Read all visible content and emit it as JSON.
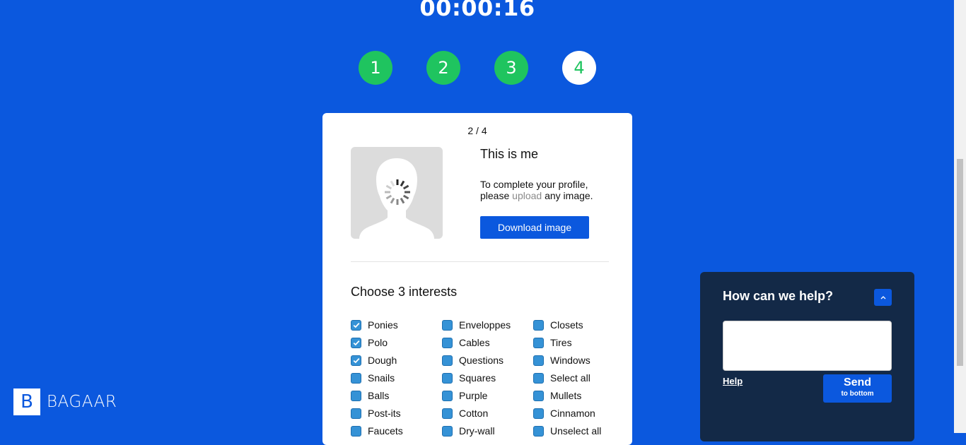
{
  "timer": "00:00:16",
  "steps": [
    "1",
    "2",
    "3",
    "4"
  ],
  "card": {
    "counter": "2 / 4",
    "profile": {
      "title": "This is me",
      "text_before": "To complete your profile, please ",
      "link": "upload",
      "text_after": " any image.",
      "button": "Download image"
    },
    "interests": {
      "title": "Choose 3 interests",
      "columns": [
        [
          {
            "label": "Ponies",
            "checked": true
          },
          {
            "label": "Polo",
            "checked": true
          },
          {
            "label": "Dough",
            "checked": true
          },
          {
            "label": "Snails",
            "checked": false
          },
          {
            "label": "Balls",
            "checked": false
          },
          {
            "label": "Post-its",
            "checked": false
          },
          {
            "label": "Faucets",
            "checked": false
          }
        ],
        [
          {
            "label": "Enveloppes",
            "checked": false
          },
          {
            "label": "Cables",
            "checked": false
          },
          {
            "label": "Questions",
            "checked": false
          },
          {
            "label": "Squares",
            "checked": false
          },
          {
            "label": "Purple",
            "checked": false
          },
          {
            "label": "Cotton",
            "checked": false
          },
          {
            "label": "Dry-wall",
            "checked": false
          }
        ],
        [
          {
            "label": "Closets",
            "checked": false
          },
          {
            "label": "Tires",
            "checked": false
          },
          {
            "label": "Windows",
            "checked": false
          },
          {
            "label": "Select all",
            "checked": false
          },
          {
            "label": "Mullets",
            "checked": false
          },
          {
            "label": "Cinnamon",
            "checked": false
          },
          {
            "label": "Unselect all",
            "checked": false
          }
        ]
      ]
    }
  },
  "logo": {
    "letter": "B",
    "name": "BAGAAR"
  },
  "help": {
    "title": "How can we help?",
    "collapse_icon": "chevron-up-icon",
    "help_link": "Help",
    "send_label": "Send",
    "send_sub": "to bottom"
  },
  "colors": {
    "background": "#0b58de",
    "step_done": "#1fc45f",
    "help_panel": "#132947",
    "checkbox": "#3592d6"
  }
}
